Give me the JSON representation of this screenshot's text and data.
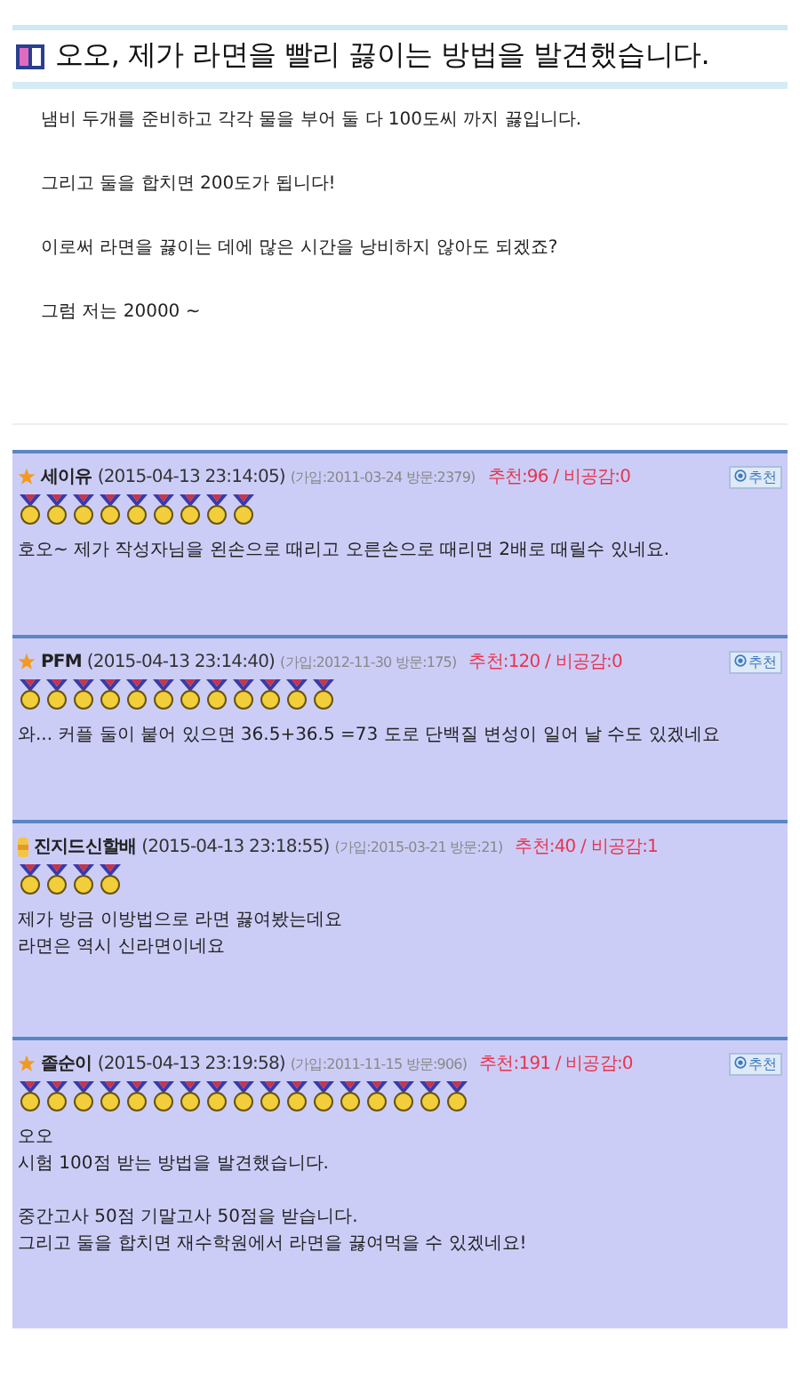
{
  "post": {
    "title": "오오, 제가 라면을 빨리 끓이는 방법을 발견했습니다.",
    "paragraphs": [
      "냄비 두개를 준비하고 각각 물을 부어 둘 다 100도씨 까지 끓입니다.",
      "그리고 둘을 합치면 200도가 됩니다!",
      "이로써 라면을 끓이는 데에 많은 시간을 낭비하지 않아도 되겠죠?",
      "그럼 저는 20000 ~"
    ]
  },
  "comments": [
    {
      "kind": "star",
      "author": "세이유",
      "time": "(2015-04-13 23:14:05)",
      "member": "(가입:2011-03-24 방문:2379)",
      "votes": "추천:96 / 비공감:0",
      "recommend": "추천",
      "badges": [
        {
          "kind": "medal"
        },
        {
          "kind": "medal"
        },
        {
          "kind": "medal"
        },
        {
          "kind": "medal"
        },
        {
          "kind": "medal"
        },
        {
          "kind": "medal"
        },
        {
          "kind": "medal"
        },
        {
          "kind": "medal"
        },
        {
          "kind": "medal"
        }
      ],
      "blocks": [
        [
          "호오~ 제가 작성자님을 왼손으로 때리고 오른손으로 때리면 2배로 때릴수 있네요."
        ]
      ]
    },
    {
      "kind": "star",
      "author": "PFM",
      "time": "(2015-04-13 23:14:40)",
      "member": "(가입:2012-11-30 방문:175)",
      "votes": "추천:120 / 비공감:0",
      "recommend": "추천",
      "badges": [
        {
          "kind": "medal"
        },
        {
          "kind": "medal"
        },
        {
          "kind": "medal"
        },
        {
          "kind": "medal"
        },
        {
          "kind": "medal"
        },
        {
          "kind": "medal"
        },
        {
          "kind": "medal"
        },
        {
          "kind": "medal"
        },
        {
          "kind": "medal"
        },
        {
          "kind": "medal"
        },
        {
          "kind": "medal"
        },
        {
          "kind": "medal"
        }
      ],
      "blocks": [
        [
          "와... 커플 둘이 붙어 있으면 36.5+36.5 =73 도로 단백질 변성이 일어 날 수도 있겠네요"
        ]
      ]
    },
    {
      "kind": "rank",
      "author": "진지드신할배",
      "time": "(2015-04-13 23:18:55)",
      "member": "(가입:2015-03-21 방문:21)",
      "votes": "추천:40 / 비공감:1",
      "badges": [
        {
          "kind": "medal"
        },
        {
          "kind": "medal"
        },
        {
          "kind": "medal"
        },
        {
          "kind": "medal"
        }
      ],
      "blocks": [
        [
          "제가 방금 이방법으로 라면 끓여봤는데요",
          "라면은 역시 신라면이네요"
        ]
      ]
    },
    {
      "kind": "star",
      "author": "졸순이",
      "time": "(2015-04-13 23:19:58)",
      "member": "(가입:2011-11-15 방문:906)",
      "votes": "추천:191 / 비공감:0",
      "recommend": "추천",
      "badges": [
        {
          "kind": "medal"
        },
        {
          "kind": "medal"
        },
        {
          "kind": "medal"
        },
        {
          "kind": "medal"
        },
        {
          "kind": "medal"
        },
        {
          "kind": "medal"
        },
        {
          "kind": "medal"
        },
        {
          "kind": "medal"
        },
        {
          "kind": "medal"
        },
        {
          "kind": "medal"
        },
        {
          "kind": "medal"
        },
        {
          "kind": "medal"
        },
        {
          "kind": "medal"
        },
        {
          "kind": "medal"
        },
        {
          "kind": "medal"
        },
        {
          "kind": "medal"
        },
        {
          "kind": "medal"
        }
      ],
      "blocks": [
        [
          "오오",
          "시험 100점 받는 방법을 발견했습니다."
        ],
        [
          "중간고사 50점 기말고사 50점을 받습니다.",
          "그리고 둘을 합치면 재수학원에서 라면을 끓여먹을 수 있겠네요!"
        ]
      ]
    }
  ]
}
